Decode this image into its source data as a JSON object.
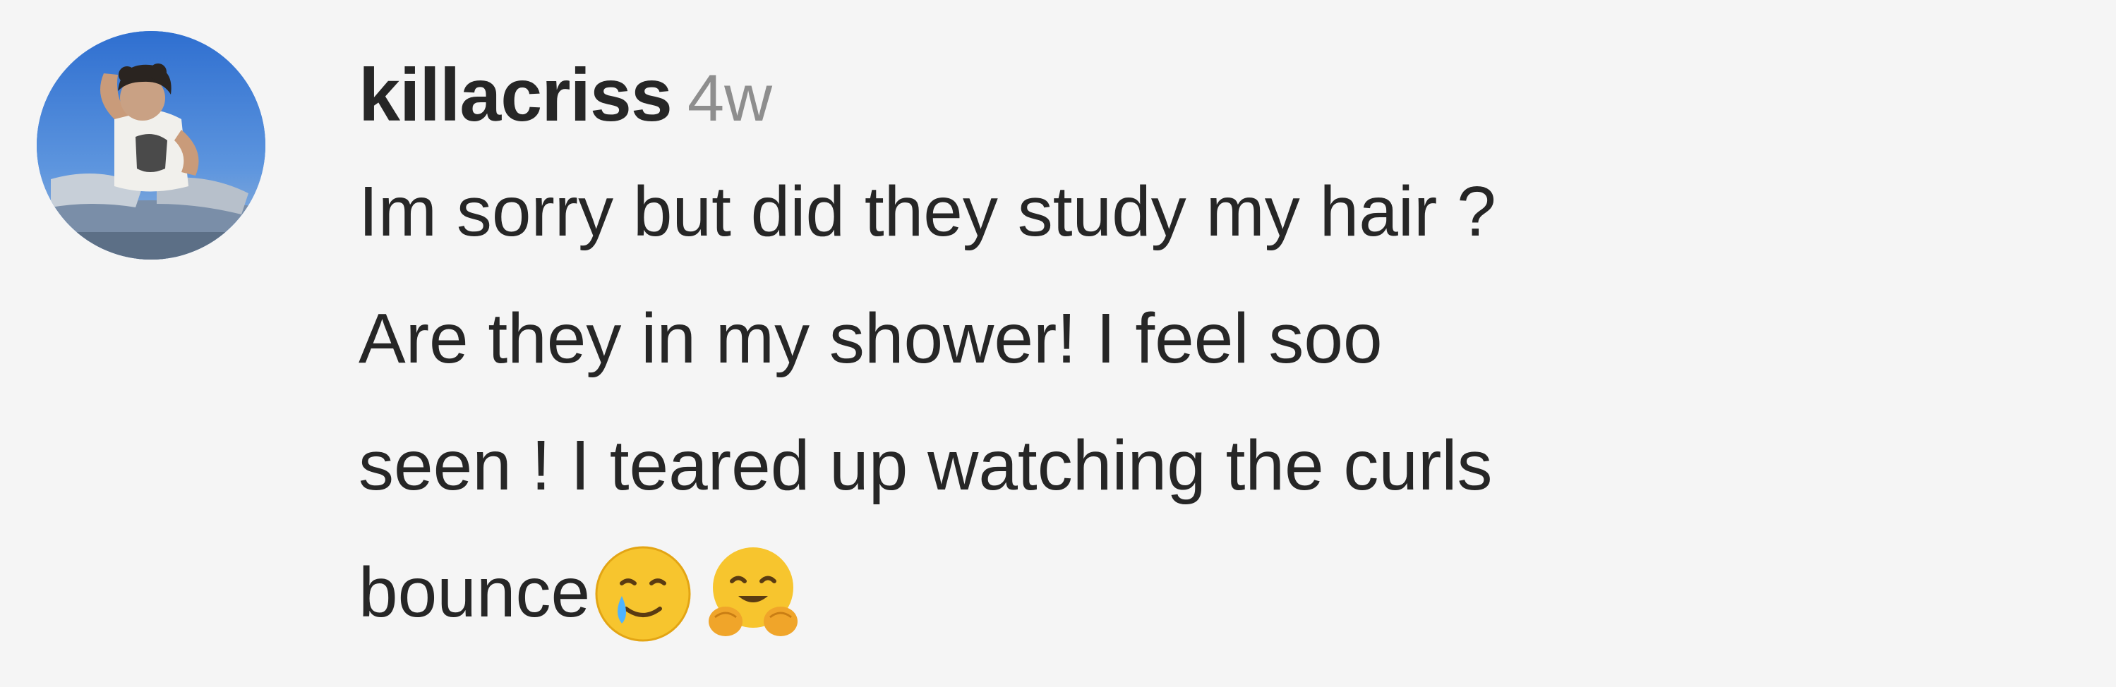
{
  "comment": {
    "username": "killacriss",
    "age": "4w",
    "text_lines": [
      "Im sorry but did they study my hair ?",
      "Are they in my shower! I feel soo",
      "seen ! I teared up watching the curls",
      "bounce"
    ],
    "emojis": [
      "smiling-face-with-tear-icon",
      "hugging-face-icon"
    ]
  },
  "colors": {
    "background": "#f5f5f5",
    "username": "#262626",
    "timestamp": "#8e8e8e",
    "text": "#262626"
  }
}
